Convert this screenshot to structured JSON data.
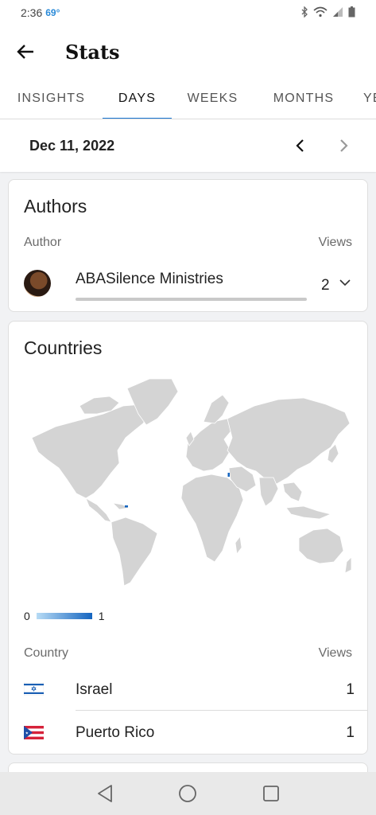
{
  "status": {
    "time": "2:36",
    "temp": "69°"
  },
  "app_bar": {
    "title": "Stats",
    "back_icon": "arrow-left-icon"
  },
  "tabs": [
    {
      "label": "INSIGHTS",
      "active": false
    },
    {
      "label": "DAYS",
      "active": true
    },
    {
      "label": "WEEKS",
      "active": false
    },
    {
      "label": "MONTHS",
      "active": false
    },
    {
      "label": "YE",
      "active": false
    }
  ],
  "date_bar": {
    "date": "Dec 11, 2022",
    "prev_icon": "chevron-left-icon",
    "next_icon": "chevron-right-icon"
  },
  "authors": {
    "title": "Authors",
    "col_author": "Author",
    "col_views": "Views",
    "items": [
      {
        "name": "ABASilence Ministries",
        "views": "2"
      }
    ]
  },
  "countries": {
    "title": "Countries",
    "legend_min": "0",
    "legend_max": "1",
    "col_country": "Country",
    "col_views": "Views",
    "items": [
      {
        "name": "Israel",
        "views": "1",
        "flag": "israel-flag-icon"
      },
      {
        "name": "Puerto Rico",
        "views": "1",
        "flag": "puerto-rico-flag-icon"
      }
    ]
  },
  "colors": {
    "accent": "#1976d2",
    "map_land": "#d4d4d4",
    "map_highlight": "#1565c0"
  }
}
